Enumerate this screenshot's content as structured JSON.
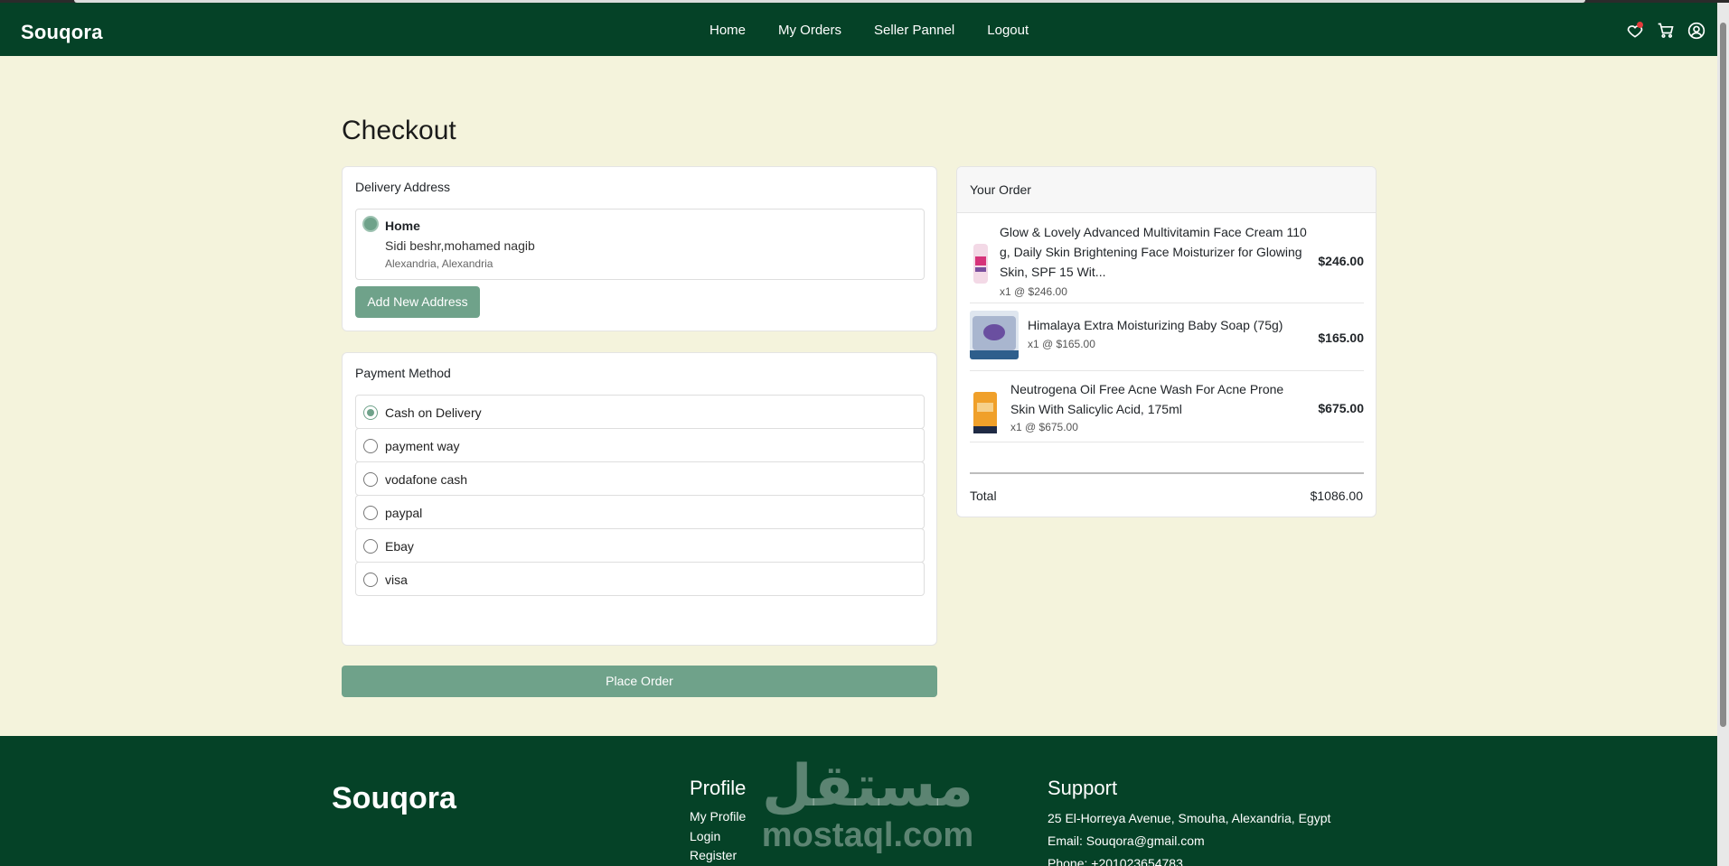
{
  "brand": "Souqora",
  "nav": {
    "links": [
      "Home",
      "My Orders",
      "Seller Pannel",
      "Logout"
    ],
    "icons": [
      "heart-icon",
      "cart-icon",
      "user-circle-icon"
    ],
    "notification_color": "#e23b3b"
  },
  "page_title": "Checkout",
  "delivery": {
    "title": "Delivery Address",
    "address": {
      "name": "Home",
      "line": "Sidi beshr,mohamed nagib",
      "city": "Alexandria, Alexandria"
    },
    "add_button": "Add New Address"
  },
  "payment": {
    "title": "Payment Method",
    "selected": "Cash on Delivery",
    "options": [
      "Cash on Delivery",
      "payment way",
      "vodafone cash",
      "paypal",
      "Ebay",
      "visa"
    ]
  },
  "place_order_label": "Place Order",
  "order": {
    "title": "Your Order",
    "items": [
      {
        "name": "Glow & Lovely Advanced Multivitamin Face Cream 110 g, Daily Skin Brightening Face Moisturizer for Glowing Skin, SPF 15 Wit...",
        "qty": "x1 @ $246.00",
        "price": "$246.00"
      },
      {
        "name": "Himalaya Extra Moisturizing Baby Soap (75g)",
        "qty": "x1 @ $165.00",
        "price": "$165.00"
      },
      {
        "name": "Neutrogena Oil Free Acne Wash For Acne Prone Skin With Salicylic Acid, 175ml",
        "qty": "x1 @ $675.00",
        "price": "$675.00"
      }
    ],
    "total_label": "Total",
    "total_value": "$1086.00"
  },
  "footer": {
    "brand": "Souqora",
    "profile": {
      "title": "Profile",
      "links": [
        "My Profile",
        "Login",
        "Register"
      ]
    },
    "support": {
      "title": "Support",
      "address": "25 El-Horreya Avenue, Smouha, Alexandria, Egypt",
      "email": "Email: Souqora@gmail.com",
      "phone": "Phone: +201023654783"
    },
    "watermark": {
      "arabic": "مستقل",
      "latin": "mostaql.com"
    }
  },
  "colors": {
    "primary": "#054227",
    "accent": "#6fa28a",
    "background": "#f4f3dc"
  }
}
